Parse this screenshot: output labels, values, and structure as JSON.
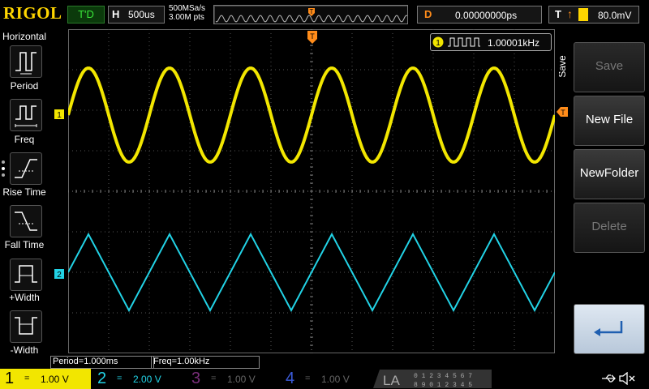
{
  "header": {
    "logo": "RIGOL",
    "run_state": "T'D",
    "horizontal_label": "H",
    "timebase": "500us",
    "sample_rate": "500MSa/s",
    "memory_depth": "3.00M pts",
    "trigger_position_marker": "T",
    "delay_label": "D",
    "delay_value": "0.00000000ps",
    "trigger_label": "T",
    "trigger_level": "80.0mV"
  },
  "left_menu": {
    "title": "Horizontal",
    "items": [
      {
        "label": "Period",
        "icon": "period-icon"
      },
      {
        "label": "Freq",
        "icon": "frequency-icon"
      },
      {
        "label": "Rise Time",
        "icon": "rise-time-icon"
      },
      {
        "label": "Fall Time",
        "icon": "fall-time-icon"
      },
      {
        "label": "+Width",
        "icon": "positive-width-icon"
      },
      {
        "label": "-Width",
        "icon": "negative-width-icon"
      }
    ]
  },
  "display": {
    "counter_channel": "1",
    "counter_value": "1.00001kHz",
    "ch1_marker": "1",
    "ch2_marker": "2",
    "trigger_level_marker": "T",
    "ch1_color": "#f2e600",
    "ch2_color": "#22d3e6"
  },
  "right_menu": {
    "title": "Save",
    "items": [
      {
        "label": "Save",
        "enabled": false
      },
      {
        "label": "New File",
        "enabled": true
      },
      {
        "label": "NewFolder",
        "enabled": true
      },
      {
        "label": "Delete",
        "enabled": false
      },
      {
        "label": "",
        "icon": "enter-arrow-icon",
        "enabled": true
      }
    ]
  },
  "measurements": {
    "period": "Period=1.000ms",
    "freq": "Freq=1.00kHz"
  },
  "channels": [
    {
      "number": "1",
      "scale": "1.00 V",
      "coupling": "=",
      "color": "#f2e600",
      "active": true
    },
    {
      "number": "2",
      "scale": "2.00 V",
      "coupling": "=",
      "color": "#22d3e6",
      "active": true
    },
    {
      "number": "3",
      "scale": "1.00 V",
      "coupling": "=",
      "color": "#b02fb0",
      "active": false
    },
    {
      "number": "4",
      "scale": "1.00 V",
      "coupling": "=",
      "color": "#3b5bd9",
      "active": false
    }
  ],
  "logic_analyzer": {
    "label": "LA",
    "row1": "0 1 2 3  4 5 6 7",
    "row2": "8 9 0 1  2 3 4 5"
  },
  "status_icons": [
    "usb-icon",
    "sound-icon"
  ]
}
